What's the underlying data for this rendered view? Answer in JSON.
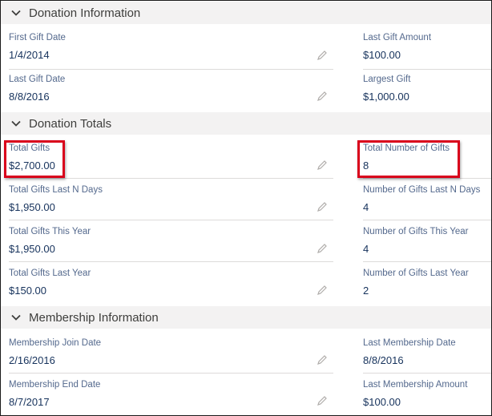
{
  "sections": {
    "donation_info": {
      "title": "Donation Information",
      "first_gift_date": {
        "label": "First Gift Date",
        "value": "1/4/2014"
      },
      "last_gift_amount": {
        "label": "Last Gift Amount",
        "value": "$100.00"
      },
      "last_gift_date": {
        "label": "Last Gift Date",
        "value": "8/8/2016"
      },
      "largest_gift": {
        "label": "Largest Gift",
        "value": "$1,000.00"
      }
    },
    "donation_totals": {
      "title": "Donation Totals",
      "total_gifts": {
        "label": "Total Gifts",
        "value": "$2,700.00"
      },
      "total_number_of_gifts": {
        "label": "Total Number of Gifts",
        "value": "8"
      },
      "total_gifts_last_n_days": {
        "label": "Total Gifts Last N Days",
        "value": "$1,950.00"
      },
      "number_of_gifts_last_n_days": {
        "label": "Number of Gifts Last N Days",
        "value": "4"
      },
      "total_gifts_this_year": {
        "label": "Total Gifts This Year",
        "value": "$1,950.00"
      },
      "number_of_gifts_this_year": {
        "label": "Number of Gifts This Year",
        "value": "4"
      },
      "total_gifts_last_year": {
        "label": "Total Gifts Last Year",
        "value": "$150.00"
      },
      "number_of_gifts_last_year": {
        "label": "Number of Gifts Last Year",
        "value": "2"
      }
    },
    "membership_info": {
      "title": "Membership Information",
      "membership_join_date": {
        "label": "Membership Join Date",
        "value": "2/16/2016"
      },
      "last_membership_date": {
        "label": "Last Membership Date",
        "value": "8/8/2016"
      },
      "membership_end_date": {
        "label": "Membership End Date",
        "value": "8/7/2017"
      },
      "last_membership_amount": {
        "label": "Last Membership Amount",
        "value": "$100.00"
      }
    }
  },
  "icons": {
    "chevron": "chevron-down-icon",
    "edit": "pencil-edit-icon"
  },
  "colors": {
    "section_header_bg": "#f3f2f2",
    "label": "#54698d",
    "value": "#16325c",
    "highlight": "#d9001b"
  }
}
